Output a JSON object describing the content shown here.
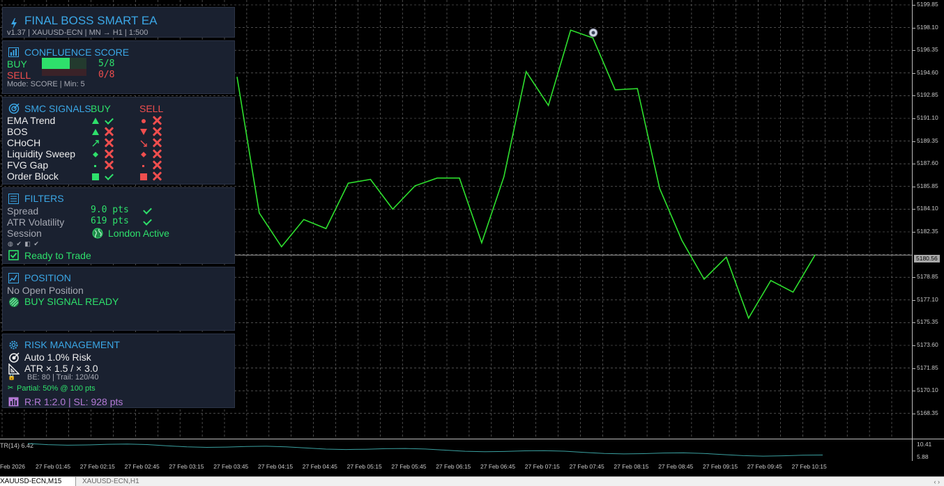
{
  "header": {
    "title": "FINAL BOSS SMART EA",
    "subtitle": "v1.37  |  XAUUSD-ECN  |  MN → H1  |  1:500"
  },
  "confluence": {
    "title": "CONFLUENCE SCORE",
    "buy_label": "BUY",
    "buy_value": "5/8",
    "buy_fraction": 0.625,
    "sell_label": "SELL",
    "sell_value": "0/8",
    "sell_fraction": 0,
    "mode": "Mode: SCORE  |  Min: 5"
  },
  "smc": {
    "title": "SMC SIGNALS",
    "buy_header": "BUY",
    "sell_header": "SELL",
    "rows": [
      {
        "label": "EMA Trend",
        "buy_icon": "triangle-up",
        "buy_ok": true,
        "sell_icon": "dot",
        "sell_ok": false
      },
      {
        "label": "BOS",
        "buy_icon": "triangle-up",
        "buy_ok": false,
        "sell_icon": "triangle-down",
        "sell_ok": false
      },
      {
        "label": "CHoCH",
        "buy_icon": "arrow-up-right",
        "buy_ok": false,
        "sell_icon": "arrow-down-right",
        "sell_ok": false
      },
      {
        "label": "Liquidity Sweep",
        "buy_icon": "diamond",
        "buy_ok": false,
        "sell_icon": "diamond",
        "sell_ok": false
      },
      {
        "label": "FVG Gap",
        "buy_icon": "small-dot",
        "buy_ok": false,
        "sell_icon": "small-dot",
        "sell_ok": false
      },
      {
        "label": "Order Block",
        "buy_icon": "square",
        "buy_ok": true,
        "sell_icon": "square",
        "sell_ok": false
      }
    ]
  },
  "filters": {
    "title": "FILTERS",
    "spread_label": "Spread",
    "spread_value": "9.0 pts",
    "atr_label": "ATR Volatility",
    "atr_value": "619 pts",
    "session_label": "Session",
    "session_value": "London Active",
    "status": "Ready to Trade"
  },
  "position": {
    "title": "POSITION",
    "status": "No Open Position",
    "signal": "BUY SIGNAL READY"
  },
  "risk": {
    "title": "RISK MANAGEMENT",
    "risk_mode": "Auto 1.0% Risk",
    "atr_mult": "ATR × 1.5 / × 3.0",
    "be_trail": "BE: 80  |  Trail: 120/40",
    "partial": "Partial: 50% @ 100 pts",
    "rr": "R:R 1:2.0  |  SL: 928 pts"
  },
  "chart": {
    "y_labels": [
      "5199.85",
      "5198.10",
      "5196.35",
      "5194.60",
      "5192.85",
      "5191.10",
      "5189.35",
      "5187.60",
      "5185.85",
      "5184.10",
      "5182.35",
      "5178.85",
      "5177.10",
      "5175.35",
      "5173.60",
      "5171.85",
      "5170.10",
      "5168.35"
    ],
    "current_price": "5180.56",
    "x_labels": [
      "Feb 2026",
      "27 Feb 01:45",
      "27 Feb 02:15",
      "27 Feb 02:45",
      "27 Feb 03:15",
      "27 Feb 03:45",
      "27 Feb 04:15",
      "27 Feb 04:45",
      "27 Feb 05:15",
      "27 Feb 05:45",
      "27 Feb 06:15",
      "27 Feb 06:45",
      "27 Feb 07:15",
      "27 Feb 07:45",
      "27 Feb 08:15",
      "27 Feb 08:45",
      "27 Feb 09:15",
      "27 Feb 09:45",
      "27 Feb 10:15"
    ],
    "atr_label": "TR(14) 6.42",
    "atr_scale_top": "10.41",
    "atr_scale_bottom": "5.88",
    "line_color": "#2ee02e",
    "series": [
      5194.3,
      5183.8,
      5181.2,
      5183.3,
      5182.6,
      5186.1,
      5186.4,
      5184.1,
      5185.9,
      5186.5,
      5186.5,
      5181.5,
      5186.6,
      5194.7,
      5192.1,
      5197.9,
      5197.3,
      5193.3,
      5193.4,
      5185.7,
      5181.7,
      5178.7,
      5180.4,
      5175.7,
      5178.6,
      5177.7,
      5180.6
    ]
  },
  "tabs": {
    "active": "XAUUSD-ECN,M15",
    "inactive": "XAUUSD-ECN,H1"
  }
}
